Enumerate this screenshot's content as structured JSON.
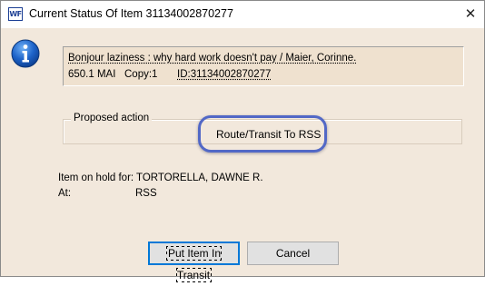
{
  "window": {
    "app_icon_text": "WF",
    "title": "Current Status Of Item 31134002870277",
    "close_glyph": "✕"
  },
  "icons": {
    "info": "info-icon",
    "close": "close-icon",
    "app": "workflows-app-icon"
  },
  "item": {
    "title_line": "Bonjour laziness : why hard work doesn't pay / Maier, Corinne.",
    "call_number": "650.1 MAI",
    "copy": "Copy:1",
    "id": "ID:31134002870277"
  },
  "proposed_action": {
    "label": "Proposed action",
    "value": "Route/Transit To RSS"
  },
  "hold": {
    "label": "Item on hold for:",
    "value": "TORTORELLA, DAWNE R.",
    "at_label": "At:",
    "at_value": "RSS"
  },
  "buttons": {
    "transit": "Put Item In Transit",
    "cancel": "Cancel"
  },
  "colors": {
    "dialog_background": "#f2e8dc",
    "highlight_ring": "#5268c6",
    "default_button_border": "#0078d7",
    "info_icon": "#1d63c9"
  }
}
